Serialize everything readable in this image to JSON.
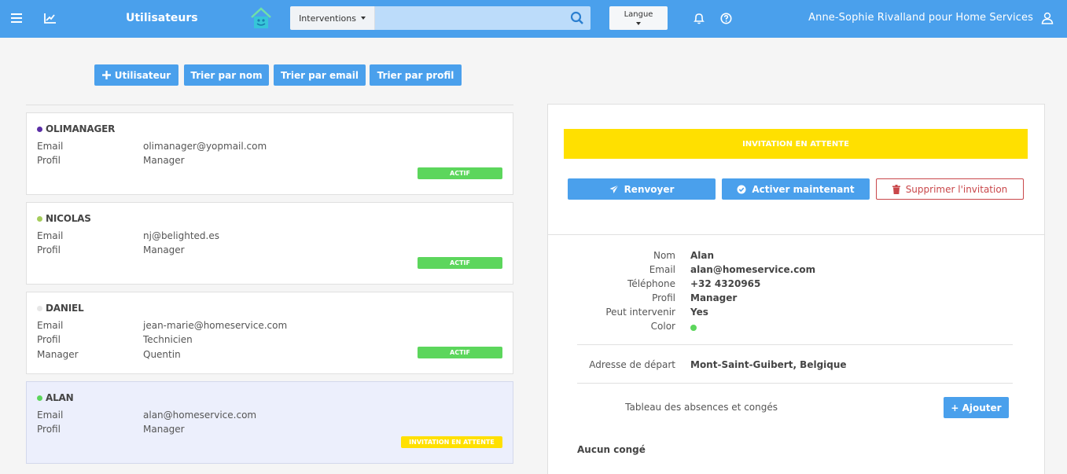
{
  "header": {
    "title": "Utilisateurs",
    "search": {
      "select_value": "Interventions",
      "value": "",
      "placeholder": ""
    },
    "langue_label": "Langue",
    "user": "Anne-Sophie Rivalland pour Home Services"
  },
  "toolbar": {
    "add_user": "Utilisateur",
    "sort_name": "Trier par nom",
    "sort_email": "Trier par email",
    "sort_profile": "Trier par profil"
  },
  "users": [
    {
      "name": "OLIMANAGER",
      "dot_color": "#5b2fa6",
      "fields": [
        {
          "label": "Email",
          "value": "olimanager@yopmail.com"
        },
        {
          "label": "Profil",
          "value": "Manager"
        }
      ],
      "status": "ACTIF"
    },
    {
      "name": "NICOLAS",
      "dot_color": "#a5cd5b",
      "fields": [
        {
          "label": "Email",
          "value": "nj@belighted.es"
        },
        {
          "label": "Profil",
          "value": "Manager"
        }
      ],
      "status": "ACTIF"
    },
    {
      "name": "DANIEL",
      "dot_color": "#e6e6e6",
      "fields": [
        {
          "label": "Email",
          "value": "jean-marie@homeservice.com"
        },
        {
          "label": "Profil",
          "value": "Technicien"
        },
        {
          "label": "Manager",
          "value": "Quentin"
        }
      ],
      "status": "ACTIF"
    },
    {
      "name": "ALAN",
      "dot_color": "#5cd65c",
      "fields": [
        {
          "label": "Email",
          "value": "alan@homeservice.com"
        },
        {
          "label": "Profil",
          "value": "Manager"
        }
      ],
      "status": "INVITATION EN ATTENTE"
    }
  ],
  "detail": {
    "banner": "INVITATION EN ATTENTE",
    "resend": "Renvoyer",
    "activate": "Activer maintenant",
    "delete": "Supprimer l'invitation",
    "labels": {
      "nom": "Nom",
      "email": "Email",
      "tel": "Téléphone",
      "profil": "Profil",
      "peut": "Peut intervenir",
      "color": "Color",
      "adresse": "Adresse de départ",
      "tableau": "Tableau des absences et congés"
    },
    "values": {
      "nom": "Alan",
      "email": "alan@homeservice.com",
      "tel": "+32 4320965",
      "profil": "Manager",
      "peut": "Yes",
      "adresse": "Mont-Saint-Guibert, Belgique"
    },
    "color_swatch": "#5cd65c",
    "add_button": "+ Ajouter",
    "empty": "Aucun congé"
  },
  "colors": {
    "primary": "#4aa0ec",
    "warning": "#ffe000",
    "success": "#5cd65c",
    "danger": "#c9474a"
  }
}
